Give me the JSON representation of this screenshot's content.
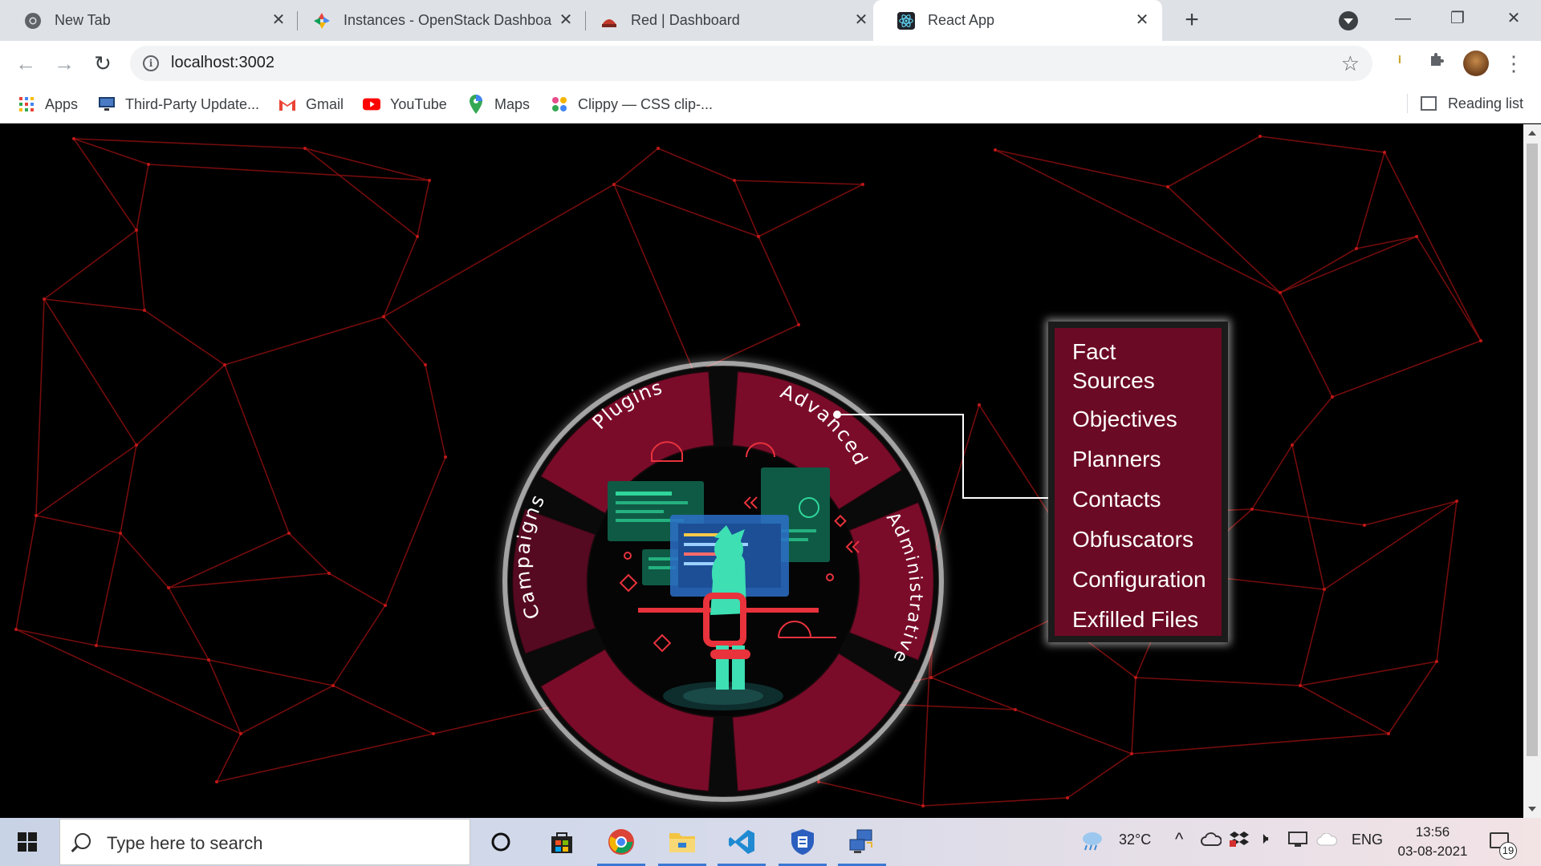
{
  "browser": {
    "tabs": [
      {
        "title": "New Tab",
        "icon": "chrome-icon"
      },
      {
        "title": "Instances - OpenStack Dashboard",
        "icon": "openstack-icon"
      },
      {
        "title": "Red | Dashboard",
        "icon": "red-team-icon"
      },
      {
        "title": "React App",
        "icon": "react-icon",
        "active": true
      }
    ],
    "url": "localhost:3002",
    "bookmarks": [
      {
        "label": "Apps",
        "icon": "apps-grid-icon"
      },
      {
        "label": "Third-Party Update...",
        "icon": "monitor-icon"
      },
      {
        "label": "Gmail",
        "icon": "gmail-icon"
      },
      {
        "label": "YouTube",
        "icon": "youtube-icon"
      },
      {
        "label": "Maps",
        "icon": "maps-pin-icon"
      },
      {
        "label": "Clippy — CSS clip-...",
        "icon": "clippy-icon"
      }
    ],
    "reading_list": "Reading list"
  },
  "app": {
    "wheel_segments": {
      "plugins": "Plugins",
      "advanced": "Advanced",
      "campaigns": "Campaigns",
      "administrative": "Administrative"
    },
    "advanced_menu": [
      "Fact Sources",
      "Objectives",
      "Planners",
      "Contacts",
      "Obfuscators",
      "Configuration",
      "Exfilled Files"
    ],
    "colors": {
      "segment": "#7a0c2a",
      "segment_dark": "#560a22",
      "network_lines": "#8a0f0f",
      "menu_bg": "#6b0a24"
    }
  },
  "taskbar": {
    "search_placeholder": "Type here to search",
    "weather": "32°C",
    "language": "ENG",
    "time": "13:56",
    "date": "03-08-2021",
    "notification_count": "19"
  }
}
